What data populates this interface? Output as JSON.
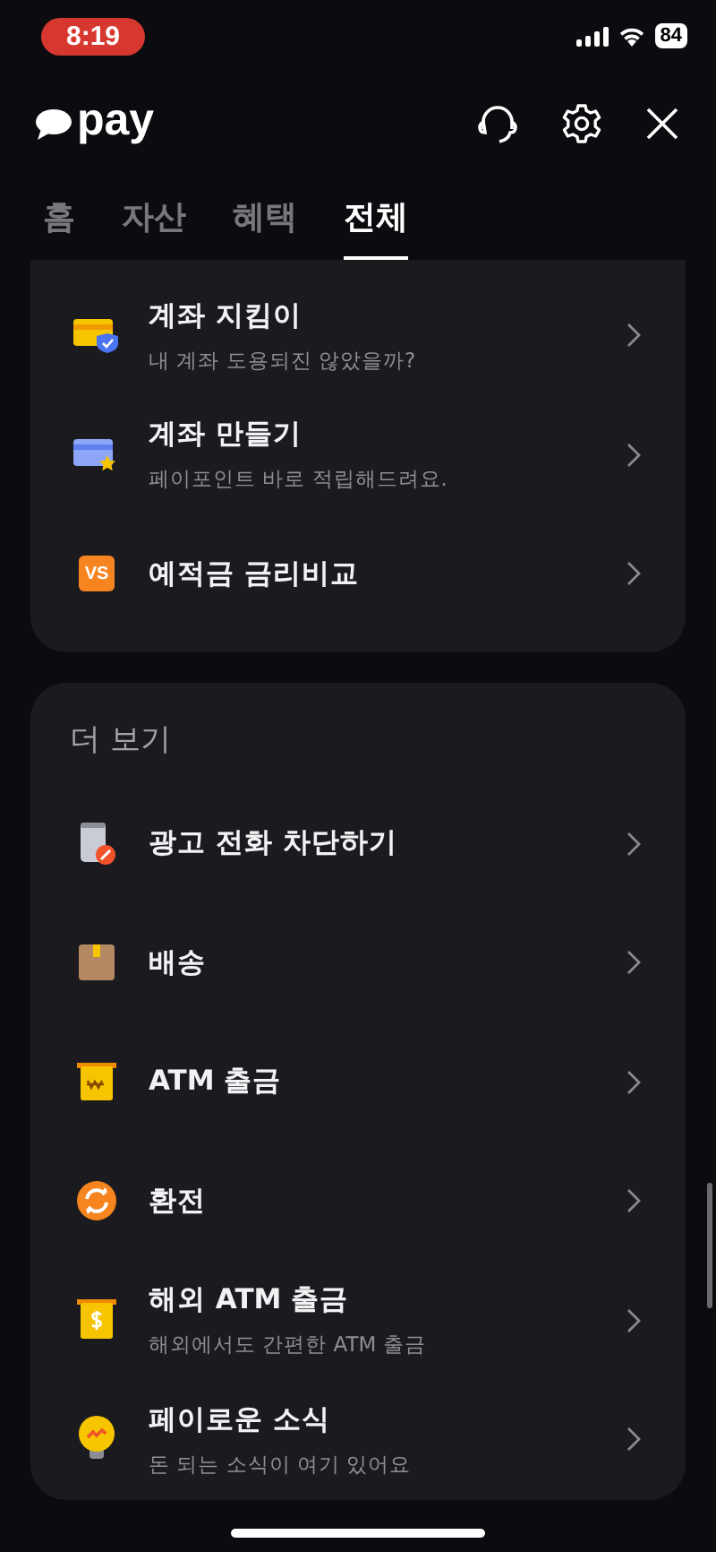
{
  "status_bar": {
    "time": "8:19",
    "battery": "84"
  },
  "header": {
    "logo": "pay"
  },
  "tabs": [
    {
      "label": "홈",
      "selected": false
    },
    {
      "label": "자산",
      "selected": false
    },
    {
      "label": "혜택",
      "selected": false
    },
    {
      "label": "전체",
      "selected": true
    }
  ],
  "account_section": {
    "items": [
      {
        "title": "계좌 지킴이",
        "subtitle": "내 계좌 도용되진 않았을까?"
      },
      {
        "title": "계좌 만들기",
        "subtitle": "페이포인트 바로 적립해드려요."
      },
      {
        "title": "예적금 금리비교",
        "icon_text": "VS"
      }
    ]
  },
  "more_section": {
    "title": "더 보기",
    "items": [
      {
        "title": "광고 전화 차단하기"
      },
      {
        "title": "배송"
      },
      {
        "title": "ATM 출금"
      },
      {
        "title": "환전"
      },
      {
        "title": "해외 ATM 출금",
        "subtitle": "해외에서도 간편한 ATM 출금"
      },
      {
        "title": "페이로운 소식",
        "subtitle": "돈 되는 소식이 여기 있어요"
      }
    ]
  }
}
